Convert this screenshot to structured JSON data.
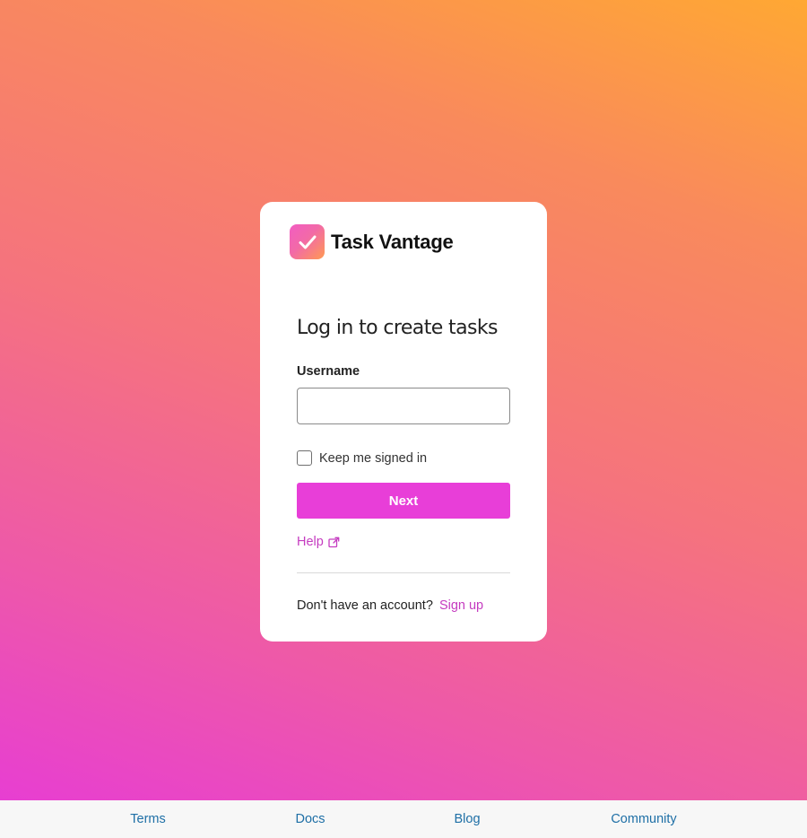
{
  "brand": {
    "name": "Task Vantage",
    "icon": "checkmark-icon"
  },
  "login": {
    "heading": "Log in to create tasks",
    "username_label": "Username",
    "username_value": "",
    "remember_label": "Keep me signed in",
    "remember_checked": false,
    "next_label": "Next",
    "help_label": "Help",
    "help_icon": "external-link-icon",
    "signup_prompt": "Don't have an account?",
    "signup_label": "Sign up"
  },
  "footer": {
    "links": [
      "Terms",
      "Docs",
      "Blog",
      "Community"
    ]
  },
  "colors": {
    "accent": "#e83ed8",
    "link": "#c53cc0",
    "footer_link": "#1e6fa6"
  }
}
